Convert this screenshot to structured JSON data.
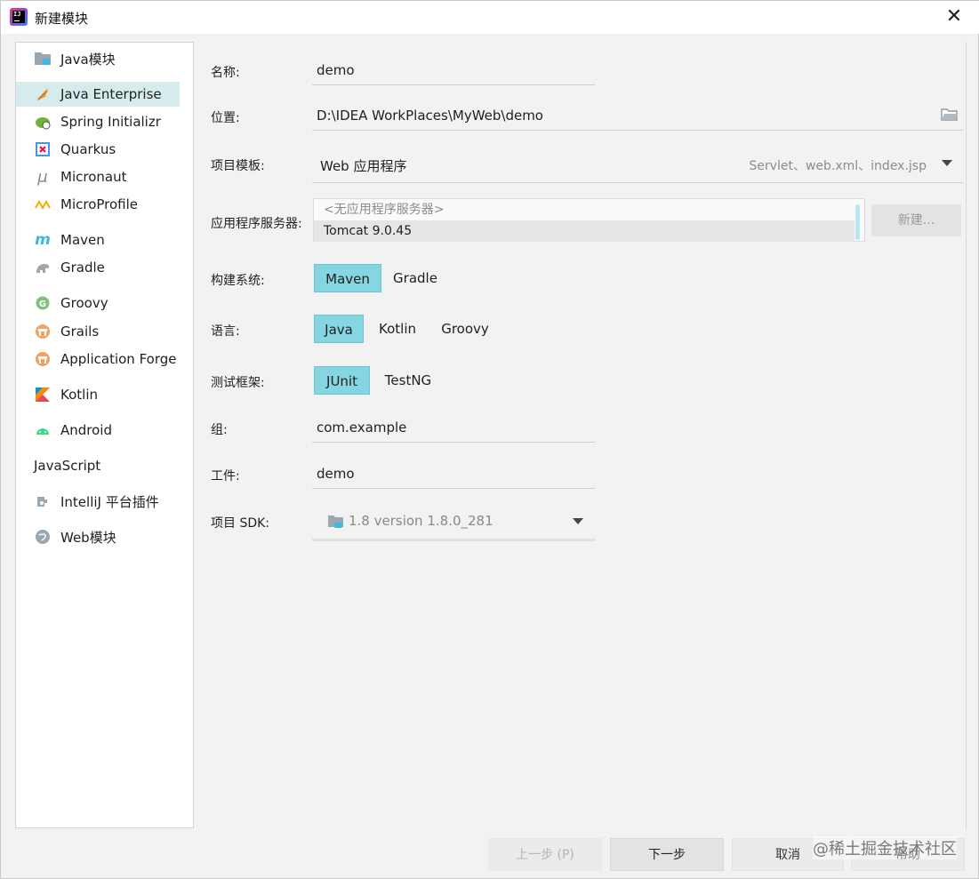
{
  "window": {
    "title": "新建模块"
  },
  "sidebar": {
    "items": [
      {
        "label": "Java模块",
        "icon": "java-module-icon"
      },
      {
        "label": "Java Enterprise",
        "icon": "java-enterprise-icon",
        "selected": true
      },
      {
        "label": "Spring Initializr",
        "icon": "spring-icon"
      },
      {
        "label": "Quarkus",
        "icon": "quarkus-icon"
      },
      {
        "label": "Micronaut",
        "icon": "micronaut-icon"
      },
      {
        "label": "MicroProfile",
        "icon": "microprofile-icon"
      },
      {
        "label": "Maven",
        "icon": "maven-icon"
      },
      {
        "label": "Gradle",
        "icon": "gradle-icon"
      },
      {
        "label": "Groovy",
        "icon": "groovy-icon"
      },
      {
        "label": "Grails",
        "icon": "grails-icon"
      },
      {
        "label": "Application Forge",
        "icon": "application-forge-icon"
      },
      {
        "label": "Kotlin",
        "icon": "kotlin-icon"
      },
      {
        "label": "Android",
        "icon": "android-icon"
      },
      {
        "label": "JavaScript",
        "icon": ""
      },
      {
        "label": "IntelliJ 平台插件",
        "icon": "plugin-icon"
      },
      {
        "label": "Web模块",
        "icon": "web-module-icon"
      }
    ]
  },
  "form": {
    "name": {
      "label": "名称:",
      "value": "demo"
    },
    "location": {
      "label": "位置:",
      "value": "D:\\IDEA WorkPlaces\\MyWeb\\demo"
    },
    "template": {
      "label": "项目模板:",
      "value": "Web 应用程序",
      "hint": "Servlet、web.xml、index.jsp"
    },
    "server": {
      "label": "应用程序服务器:",
      "options": [
        "<无应用程序服务器>",
        "Tomcat 9.0.45"
      ],
      "new_button": "新建..."
    },
    "build": {
      "label": "构建系统:",
      "options": [
        "Maven",
        "Gradle"
      ],
      "selected": "Maven"
    },
    "language": {
      "label": "语言:",
      "options": [
        "Java",
        "Kotlin",
        "Groovy"
      ],
      "selected": "Java"
    },
    "test": {
      "label": "测试框架:",
      "options": [
        "JUnit",
        "TestNG"
      ],
      "selected": "JUnit"
    },
    "group": {
      "label": "组:",
      "value": "com.example"
    },
    "artifact": {
      "label": "工件:",
      "value": "demo"
    },
    "sdk": {
      "label": "项目 SDK:",
      "value": "1.8 version 1.8.0_281"
    }
  },
  "footer": {
    "prev": "上一步 (P)",
    "next": "下一步",
    "cancel": "取消",
    "help": "帮助"
  },
  "watermark": "@稀土掘金技术社区",
  "colors": {
    "accent": "#85d5e2",
    "selected_row": "#d5ebec"
  }
}
